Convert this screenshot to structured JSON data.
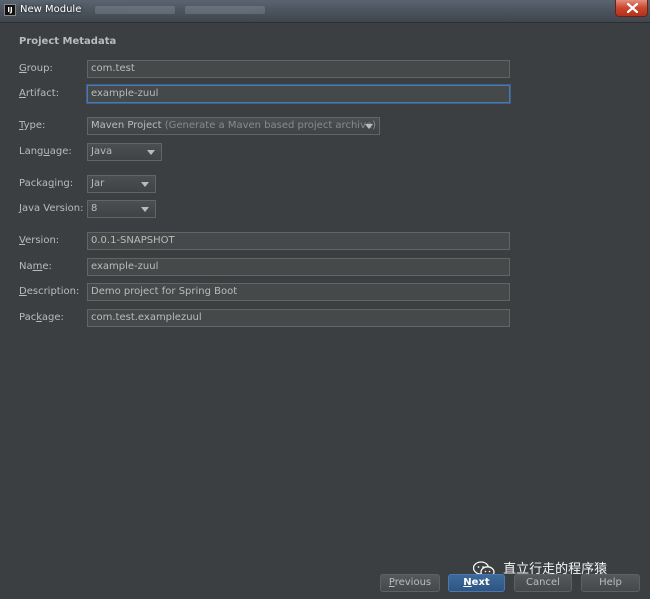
{
  "window": {
    "title": "New Module"
  },
  "section": {
    "title": "Project Metadata"
  },
  "form": {
    "group": {
      "label_mn": "G",
      "label_rest": "roup:",
      "value": "com.test"
    },
    "artifact": {
      "label_mn": "A",
      "label_rest": "rtifact:",
      "value": "example-zuul"
    },
    "type": {
      "label_mn": "T",
      "label_rest": "ype:",
      "value": "Maven Project",
      "hint": "(Generate a Maven based project archive)"
    },
    "language": {
      "label_pre": "Lang",
      "label_mn": "u",
      "label_rest": "age:",
      "value": "Java"
    },
    "packaging": {
      "label_pre": "Packa",
      "label_mn": "g",
      "label_rest": "ing:",
      "value": "Jar"
    },
    "java_version": {
      "label_mn": "J",
      "label_rest": "ava Version:",
      "value": "8"
    },
    "version": {
      "label_mn": "V",
      "label_rest": "ersion:",
      "value": "0.0.1-SNAPSHOT"
    },
    "name": {
      "label_pre": "Na",
      "label_mn": "m",
      "label_rest": "e:",
      "value": "example-zuul"
    },
    "description": {
      "label_mn": "D",
      "label_rest": "escription:",
      "value": "Demo project for Spring Boot"
    },
    "package": {
      "label_pre": "Pac",
      "label_mn": "k",
      "label_rest": "age:",
      "value": "com.test.examplezuul"
    }
  },
  "buttons": {
    "previous": {
      "mn": "P",
      "rest": "revious"
    },
    "next": {
      "mn": "N",
      "rest": "ext"
    },
    "cancel": "Cancel",
    "help": "Help"
  },
  "watermark": {
    "text": "直立行走的程序猿"
  },
  "colors": {
    "background": "#3c3f41",
    "field": "#45494a",
    "focus": "#4a78b5",
    "primary_button": "#365f8c"
  }
}
